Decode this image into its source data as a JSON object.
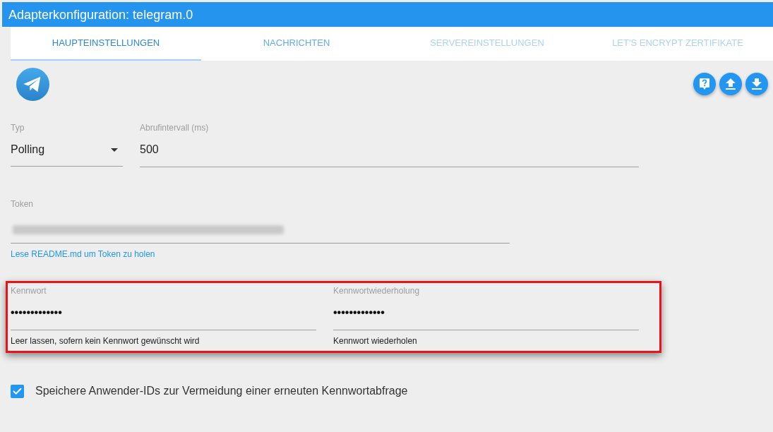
{
  "window": {
    "title": "Adapterkonfiguration: telegram.0"
  },
  "tabs": [
    {
      "label": "HAUPTEINSTELLUNGEN",
      "selected": true,
      "disabled": false
    },
    {
      "label": "NACHRICHTEN",
      "selected": false,
      "disabled": false
    },
    {
      "label": "SERVEREINSTELLUNGEN",
      "selected": false,
      "disabled": true
    },
    {
      "label": "LET'S ENCRYPT ZERTIFIKATE",
      "selected": false,
      "disabled": true
    }
  ],
  "toolbar": {
    "buttons": [
      {
        "kind": "help"
      },
      {
        "kind": "upload"
      },
      {
        "kind": "download"
      }
    ]
  },
  "type_select": {
    "label": "Typ",
    "value": "Polling"
  },
  "poll_interval": {
    "label": "Abrufintervall (ms)",
    "value": "500"
  },
  "token": {
    "label": "Token",
    "redacted": true,
    "helper": "Lese README.md um Token zu holen"
  },
  "password_section": {
    "highlighted": true,
    "fields": [
      {
        "label": "Kennwort",
        "value": "•••••••••••••",
        "helper": "Leer lassen, sofern kein Kennwort gewünscht wird"
      },
      {
        "label": "Kennwortwiederholung",
        "value": "•••••••••••••",
        "helper": "Kennwort wiederholen"
      }
    ]
  },
  "save_user_ids": {
    "label": "Speichere Anwender-IDs zur Vermeidung einer erneuten Kennwortabfrage",
    "checked": true
  }
}
